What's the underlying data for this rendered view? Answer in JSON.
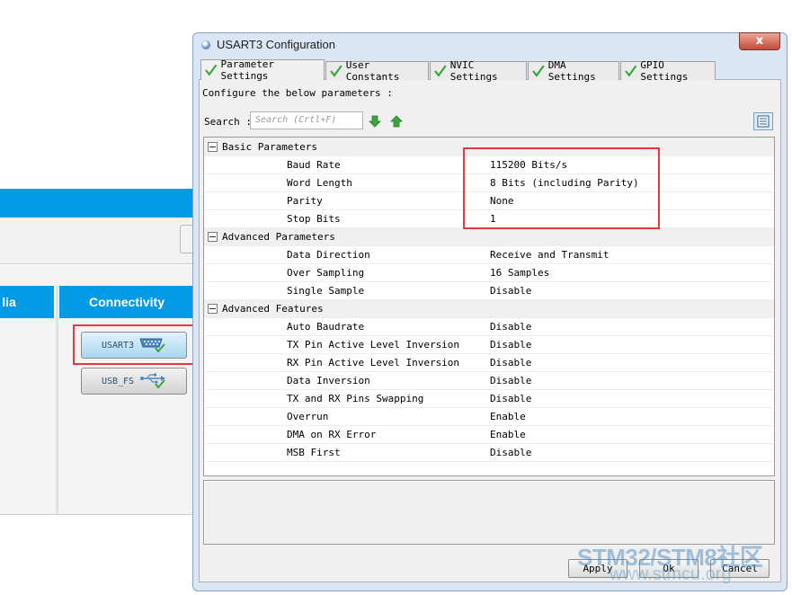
{
  "background_app": {
    "categories": {
      "media_partial": "lia",
      "connectivity": "Connectivity"
    },
    "peripherals": [
      {
        "label": "USART3",
        "icon": "serial-port-icon",
        "selected": true
      },
      {
        "label": "USB_FS",
        "icon": "usb-icon",
        "selected": false
      }
    ]
  },
  "dialog": {
    "title": "USART3 Configuration",
    "close_glyph": "x",
    "tabs": [
      {
        "label": "Parameter Settings",
        "active": true
      },
      {
        "label": "User Constants",
        "active": false
      },
      {
        "label": "NVIC Settings",
        "active": false
      },
      {
        "label": "DMA Settings",
        "active": false
      },
      {
        "label": "GPIO Settings",
        "active": false
      }
    ],
    "instruction": "Configure the below parameters :",
    "search": {
      "label": "Search :",
      "placeholder": "Search (Crtl+F)"
    },
    "groups": [
      {
        "name": "Basic Parameters",
        "params": [
          {
            "name": "Baud Rate",
            "value": "115200 Bits/s"
          },
          {
            "name": "Word Length",
            "value": "8 Bits (including Parity)"
          },
          {
            "name": "Parity",
            "value": "None"
          },
          {
            "name": "Stop Bits",
            "value": "1"
          }
        ]
      },
      {
        "name": "Advanced Parameters",
        "params": [
          {
            "name": "Data Direction",
            "value": "Receive and Transmit"
          },
          {
            "name": "Over Sampling",
            "value": "16 Samples"
          },
          {
            "name": "Single Sample",
            "value": "Disable"
          }
        ]
      },
      {
        "name": "Advanced Features",
        "params": [
          {
            "name": "Auto Baudrate",
            "value": "Disable"
          },
          {
            "name": "TX Pin Active Level Inversion",
            "value": "Disable"
          },
          {
            "name": "RX Pin Active Level Inversion",
            "value": "Disable"
          },
          {
            "name": "Data Inversion",
            "value": "Disable"
          },
          {
            "name": "TX and RX Pins Swapping",
            "value": "Disable"
          },
          {
            "name": "Overrun",
            "value": "Enable"
          },
          {
            "name": "DMA on RX Error",
            "value": "Enable"
          },
          {
            "name": "MSB First",
            "value": "Disable"
          }
        ]
      }
    ],
    "buttons": {
      "apply": "Apply",
      "ok": "Ok",
      "cancel": "Cancel"
    }
  },
  "watermark": {
    "brand": "STM32/STM8社区",
    "url": "www.stmcu.org"
  },
  "colors": {
    "accent_blue": "#039be5",
    "highlight_red": "#e03a3a",
    "check_green": "#3aa53a"
  }
}
